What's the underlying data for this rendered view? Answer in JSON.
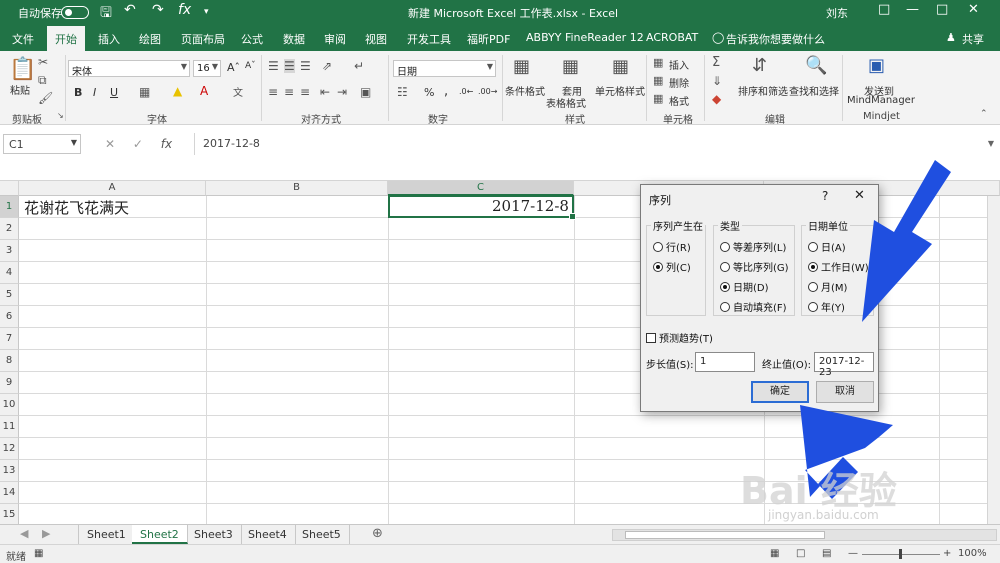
{
  "titlebar": {
    "autosave": "自动保存",
    "title": "新建 Microsoft Excel 工作表.xlsx - Excel",
    "user": "刘东",
    "save_icon": "save-icon",
    "undo_icon": "undo-icon",
    "redo_icon": "redo-icon",
    "fx_icon": "function-icon"
  },
  "tabs": [
    "文件",
    "开始",
    "插入",
    "绘图",
    "页面布局",
    "公式",
    "数据",
    "审阅",
    "视图",
    "开发工具",
    "福昕PDF",
    "ABBYY FineReader 12",
    "ACROBAT"
  ],
  "active_tab": "开始",
  "tell_me": "告诉我你想要做什么",
  "share": "共享",
  "ribbon": {
    "paste": "粘贴",
    "font_name": "宋体",
    "font_size": "16",
    "bold": "B",
    "italic": "I",
    "underline": "U",
    "number_format": "日期",
    "percent": "%",
    "comma": ",",
    "conditional_format": "条件格式",
    "table_format_line1": "套用",
    "table_format_line2": "表格格式",
    "cell_styles": "单元格样式",
    "insert": "插入",
    "delete": "删除",
    "format": "格式",
    "sort_filter": "排序和筛选",
    "find_select": "查找和选择",
    "send_to": "发送到",
    "mindmanager": "MindManager",
    "groups": [
      "剪贴板",
      "字体",
      "对齐方式",
      "数字",
      "样式",
      "单元格",
      "编辑",
      "Mindjet"
    ]
  },
  "formula_bar": {
    "name_box": "C1",
    "fx": "fx",
    "value": "2017-12-8"
  },
  "grid": {
    "columns": [
      "A",
      "B",
      "C"
    ],
    "rows": [
      "1",
      "2",
      "3",
      "4",
      "5",
      "6",
      "7",
      "8",
      "9",
      "10",
      "11",
      "12",
      "13",
      "14",
      "15"
    ],
    "a1": "花谢花飞花满天",
    "c1": "2017-12-8"
  },
  "dialog": {
    "title": "序列",
    "help": "?",
    "close": "✕",
    "series_in": {
      "title": "序列产生在",
      "options": [
        "行(R)",
        "列(C)"
      ],
      "selected": "列(C)"
    },
    "type": {
      "title": "类型",
      "options": [
        "等差序列(L)",
        "等比序列(G)",
        "日期(D)",
        "自动填充(F)"
      ],
      "selected": "日期(D)"
    },
    "date_unit": {
      "title": "日期单位",
      "options": [
        "日(A)",
        "工作日(W)",
        "月(M)",
        "年(Y)"
      ],
      "selected": "工作日(W)"
    },
    "trend": "预测趋势(T)",
    "step_label": "步长值(S):",
    "step_value": "1",
    "stop_label": "终止值(O):",
    "stop_value": "2017-12-23",
    "ok": "确定",
    "cancel": "取消"
  },
  "sheets": [
    "Sheet1",
    "Sheet2",
    "Sheet3",
    "Sheet4",
    "Sheet5"
  ],
  "active_sheet": "Sheet2",
  "status": {
    "ready": "就绪",
    "zoom": "100%"
  },
  "watermark": {
    "brand": "Bai 经验",
    "url": "jingyan.baidu.com"
  },
  "colors": {
    "excel_green": "#217346",
    "annotation_blue": "#1f4fe0"
  }
}
